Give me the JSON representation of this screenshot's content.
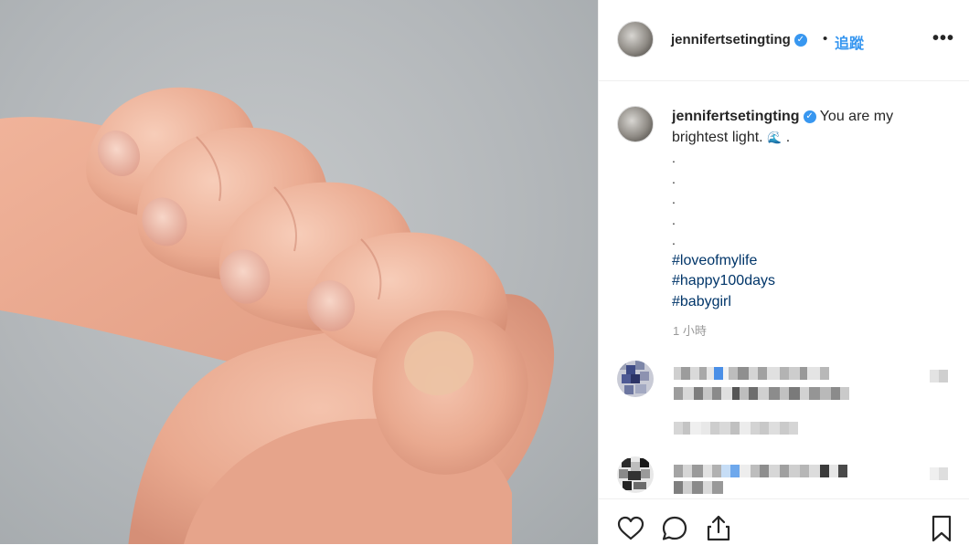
{
  "post": {
    "username": "jenniferts​etingting",
    "follow_label": "追蹤",
    "separator": "•",
    "verified_mark": "✓",
    "more_label": "•••"
  },
  "caption": {
    "username": "jenniferts​etingting",
    "text_line1": "You are my",
    "text_line2": "brightest light.",
    "emoji": "🌊",
    "trail": ".",
    "dots": [
      ".",
      ".",
      ".",
      ".",
      "."
    ],
    "hashtags": [
      "#loveofmylife",
      "#happy100days",
      "#babygirl"
    ],
    "timestamp": "1 小時"
  },
  "icons": {
    "like": "heart-icon",
    "comment": "comment-icon",
    "share": "share-icon",
    "save": "bookmark-icon"
  },
  "colors": {
    "link": "#3897f0",
    "hashtag": "#003569",
    "muted": "#999999"
  }
}
